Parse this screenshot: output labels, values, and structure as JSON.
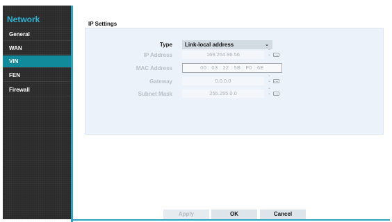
{
  "sidebar": {
    "title": "Network",
    "items": [
      {
        "label": "General"
      },
      {
        "label": "WAN"
      },
      {
        "label": "VIN"
      },
      {
        "label": "FEN"
      },
      {
        "label": "Firewall"
      }
    ],
    "active_index": 2
  },
  "main": {
    "section_title": "IP Settings",
    "fields": {
      "type": {
        "label": "Type",
        "value": "Link-local address"
      },
      "ip_address": {
        "label": "IP Address",
        "value": "169.254.96.56"
      },
      "mac_address": {
        "label": "MAC Address",
        "value": "00 : 03 : 22 : 5B : F0 : 6E"
      },
      "gateway": {
        "label": "Gateway",
        "value": "0.0.0.0"
      },
      "subnet_mask": {
        "label": "Subnet Mask",
        "value": "255.255.0.0"
      }
    }
  },
  "buttons": {
    "apply": "Apply",
    "ok": "OK",
    "cancel": "Cancel"
  },
  "icons": {
    "dropdown": "chevron-down-icon",
    "spinner": "spinner-arrows-icon",
    "keyboard": "keyboard-icon"
  },
  "colors": {
    "accent": "#2aa6c3",
    "active_item": "#118a9c",
    "sidebar_bg": "#2b2b2b",
    "panel_bg": "#ebf2f9"
  }
}
